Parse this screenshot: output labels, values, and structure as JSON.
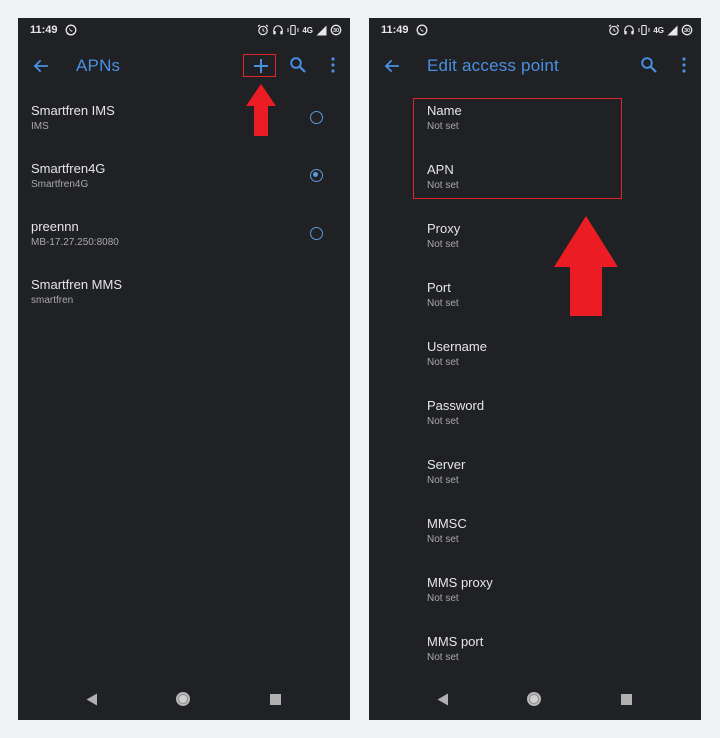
{
  "left_screen": {
    "status_bar": {
      "time": "11:49",
      "network": "4G"
    },
    "toolbar": {
      "title": "APNs",
      "back_icon": "arrow-left-icon",
      "add_icon": "plus-icon",
      "search_icon": "search-icon",
      "more_icon": "more-vert-icon"
    },
    "apn_list": [
      {
        "name": "Smartfren IMS",
        "detail": "IMS",
        "selected": false
      },
      {
        "name": "Smartfren4G",
        "detail": "Smartfren4G",
        "selected": true
      },
      {
        "name": "preennn",
        "detail": "MB-17.27.250:8080",
        "selected": false
      },
      {
        "name": "Smartfren MMS",
        "detail": "smartfren",
        "selected": null
      }
    ]
  },
  "right_screen": {
    "status_bar": {
      "time": "11:49",
      "network": "4G"
    },
    "toolbar": {
      "title": "Edit access point",
      "back_icon": "arrow-left-icon",
      "search_icon": "search-icon",
      "more_icon": "more-vert-icon"
    },
    "fields": [
      {
        "label": "Name",
        "value": "Not set"
      },
      {
        "label": "APN",
        "value": "Not set"
      },
      {
        "label": "Proxy",
        "value": "Not set"
      },
      {
        "label": "Port",
        "value": "Not set"
      },
      {
        "label": "Username",
        "value": "Not set"
      },
      {
        "label": "Password",
        "value": "Not set"
      },
      {
        "label": "Server",
        "value": "Not set"
      },
      {
        "label": "MMSC",
        "value": "Not set"
      },
      {
        "label": "MMS proxy",
        "value": "Not set"
      },
      {
        "label": "MMS port",
        "value": "Not set"
      }
    ]
  },
  "colors": {
    "background": "#eef2f5",
    "screen": "#202124",
    "accent": "#4a90e2",
    "annotation": "#e0262d"
  }
}
